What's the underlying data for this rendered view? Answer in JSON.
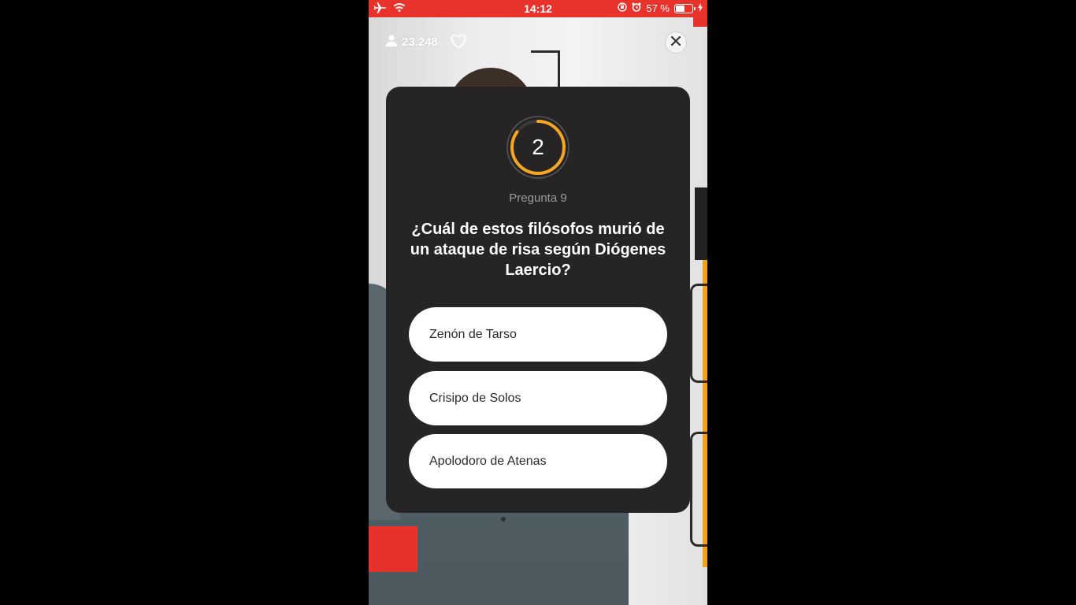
{
  "status_bar": {
    "time": "14:12",
    "battery_text": "57 %",
    "battery_level": 0.57,
    "icons": [
      "airplane-icon",
      "wifi-icon",
      "orientation-lock-icon",
      "alarm-icon",
      "battery-icon",
      "charging-icon"
    ],
    "color": "#e8322c"
  },
  "overlay": {
    "viewer_count": "23.248",
    "icons": [
      "person-icon",
      "heart-icon",
      "close-icon"
    ]
  },
  "quiz": {
    "timer_value": "2",
    "timer_progress": 0.85,
    "timer_color": "#f5a623",
    "question_label": "Pregunta 9",
    "question_text": "¿Cuál de estos filósofos murió de un ataque de risa según Diógenes Laercio?",
    "answers": [
      {
        "label": "Zenón de Tarso"
      },
      {
        "label": "Crisipo de Solos"
      },
      {
        "label": "Apolodoro de Atenas"
      }
    ]
  }
}
